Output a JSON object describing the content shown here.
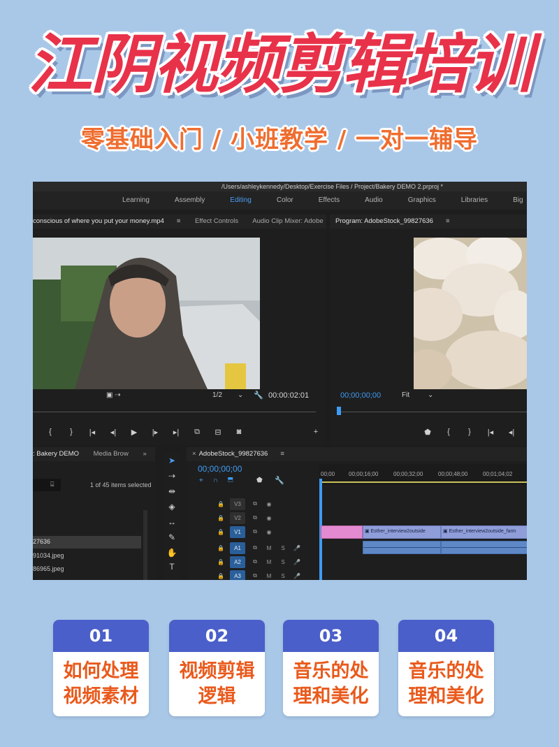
{
  "title": "江阴视频剪辑培训",
  "subtitle": "零基础入门 / 小班教学 / 一对一辅导",
  "premiere": {
    "path": "/Users/ashleykennedy/Desktop/Exercise Files / Project/Bakery DEMO 2.prproj *",
    "workspaces": [
      "Learning",
      "Assembly",
      "Editing",
      "Color",
      "Effects",
      "Audio",
      "Graphics",
      "Libraries",
      "Big Timeline"
    ],
    "source_tabs": [
      "conscious of where you put your money.mp4",
      "Effect Controls",
      "Audio Clip Mixer: Adobe"
    ],
    "program_title": "Program: AdobeStock_99827636",
    "source_zoom": "1/2",
    "source_timecode": "00:00:02:01",
    "program_timecode": "00;00;00;00",
    "program_fit": "Fit",
    "project_tabs": [
      ": Bakery DEMO",
      "Media Brow"
    ],
    "project_count": "1 of 45 items selected",
    "project_items": [
      "27636",
      "91034.jpeg",
      "86965.jpeg"
    ],
    "sequence_name": "AdobeStock_99827636",
    "sequence_timecode": "00;00;00;00",
    "ruler_labels": [
      "00;00",
      "00;00;16;00",
      "00;00;32;00",
      "00;00;48;00",
      "00;01;04;02"
    ],
    "tracks": [
      "V3",
      "V2",
      "V1",
      "A1",
      "A2",
      "A3"
    ],
    "clips": [
      "Esther_interview2outside",
      "Esther_interview2outside_farm"
    ]
  },
  "cards": [
    {
      "num": "01",
      "line1": "如何处理",
      "line2": "视频素材"
    },
    {
      "num": "02",
      "line1": "视频剪辑",
      "line2": "逻辑"
    },
    {
      "num": "03",
      "line1": "音乐的处",
      "line2": "理和美化"
    },
    {
      "num": "04",
      "line1": "音乐的处",
      "line2": "理和美化"
    }
  ],
  "colors": {
    "background": "#a9c8e8",
    "title": "#e8324a",
    "subtitle": "#ef6d2f",
    "card_header": "#4a5fc9",
    "card_text": "#e95a1c"
  }
}
